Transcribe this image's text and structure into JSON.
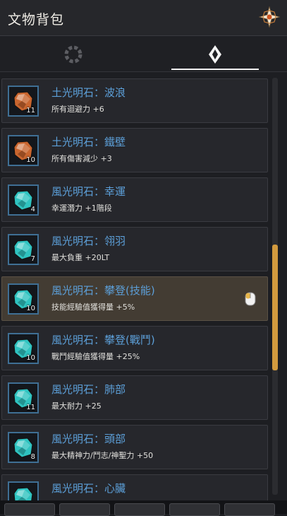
{
  "header": {
    "title": "文物背包",
    "emblem_icon": "compass-star-icon"
  },
  "tabs": [
    {
      "icon": "ring-dots-icon",
      "active": false
    },
    {
      "icon": "diamond-gem-icon",
      "active": true
    }
  ],
  "items": [
    {
      "name": "土光明石：波浪",
      "desc": "所有迴避力 +6",
      "count": "11",
      "gem": "earth",
      "selected": false
    },
    {
      "name": "土光明石：鐵壁",
      "desc": "所有傷害減少 +3",
      "count": "10",
      "gem": "earth",
      "selected": false
    },
    {
      "name": "風光明石：幸運",
      "desc": "幸運潛力 +1階段",
      "count": "4",
      "gem": "wind",
      "selected": false
    },
    {
      "name": "風光明石：翎羽",
      "desc": "最大負重 +20LT",
      "count": "7",
      "gem": "wind",
      "selected": false
    },
    {
      "name": "風光明石：攀登(技能)",
      "desc": "技能經驗值獲得量 +5%",
      "count": "10",
      "gem": "wind",
      "selected": true
    },
    {
      "name": "風光明石：攀登(戰鬥)",
      "desc": "戰鬥經驗值獲得量 +25%",
      "count": "10",
      "gem": "wind",
      "selected": false
    },
    {
      "name": "風光明石：肺部",
      "desc": "最大耐力 +25",
      "count": "11",
      "gem": "wind",
      "selected": false
    },
    {
      "name": "風光明石：頭部",
      "desc": "最大精神力/鬥志/神聖力 +50",
      "count": "8",
      "gem": "wind",
      "selected": false
    },
    {
      "name": "風光明石：心臟",
      "desc": "",
      "count": "",
      "gem": "wind",
      "selected": false
    }
  ],
  "colors": {
    "earth_gem": "#c9652e",
    "wind_gem": "#2fc3c0",
    "name_text": "#5c9fd8",
    "scroll_thumb": "#d29a3e"
  }
}
